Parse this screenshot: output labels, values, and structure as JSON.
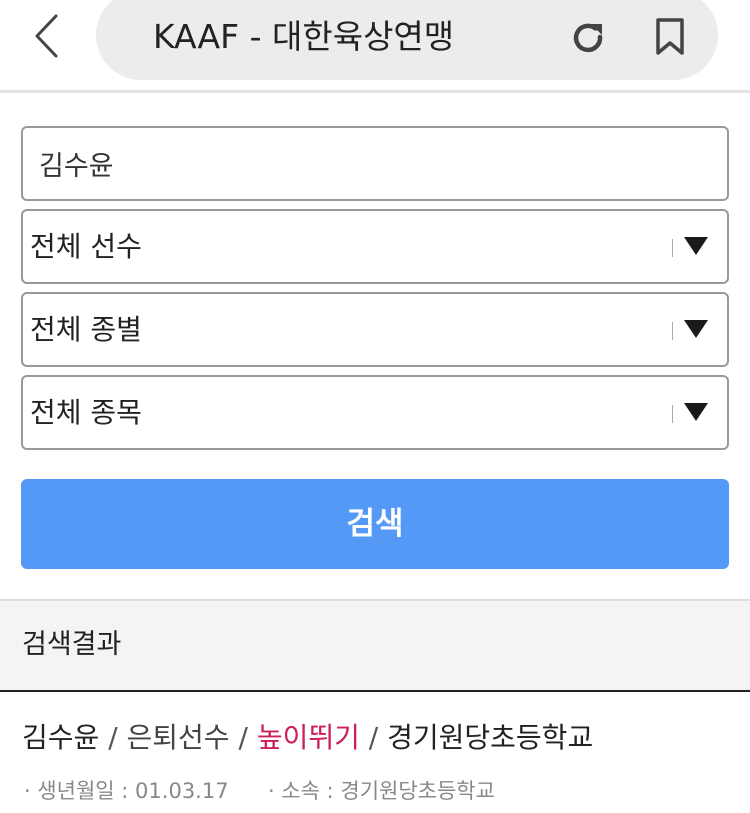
{
  "browser": {
    "page_title": "KAAF - 대한육상연맹",
    "icons": {
      "back": "chevron-left-icon",
      "reload": "reload-icon",
      "bookmark": "bookmark-icon"
    }
  },
  "search_form": {
    "name_value": "김수윤",
    "player_type": "전체 선수",
    "gender_type": "전체 종별",
    "event_type": "전체 종목",
    "search_label": "검색"
  },
  "results": {
    "header": "검색결과",
    "items": [
      {
        "name": "김수윤",
        "status": "은퇴선수",
        "event": "높이뛰기",
        "school": "경기원당초등학교",
        "birth_label": "· 생년월일 : 01.03.17",
        "affiliation_label": "· 소속 : 경기원당초등학교"
      }
    ]
  },
  "colors": {
    "accent": "#5599f7",
    "event_highlight": "#cc1f5f",
    "urlbar_bg": "#ececec"
  }
}
